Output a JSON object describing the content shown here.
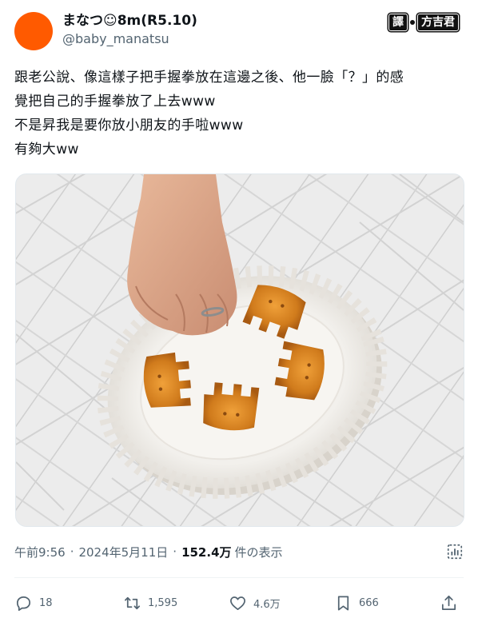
{
  "author": {
    "display_name": "まなつ☺8m(R5.10)",
    "handle": "@baby_manatsu",
    "avatar_color": "#ff5a00"
  },
  "watermark": {
    "left_label": "譯",
    "right_label": "方吉君"
  },
  "tweet": {
    "lines": [
      "跟老公說、像這樣子把手握拳放在這邊之後、他一臉「？」的感",
      "覺把自己的手握拳放了上去www",
      "不是昇我是要你放小朋友的手啦www",
      "有夠大ww"
    ]
  },
  "meta": {
    "time": "午前9:56",
    "separator": "·",
    "date": "2024年5月11日",
    "views_count": "152.4万",
    "views_label": "件の表示"
  },
  "actions": {
    "replies": "18",
    "reposts": "1,595",
    "likes": "4.6万",
    "bookmarks": "666"
  },
  "colors": {
    "text": "#0f1419",
    "secondary": "#536471",
    "divider": "#eff3f4"
  }
}
